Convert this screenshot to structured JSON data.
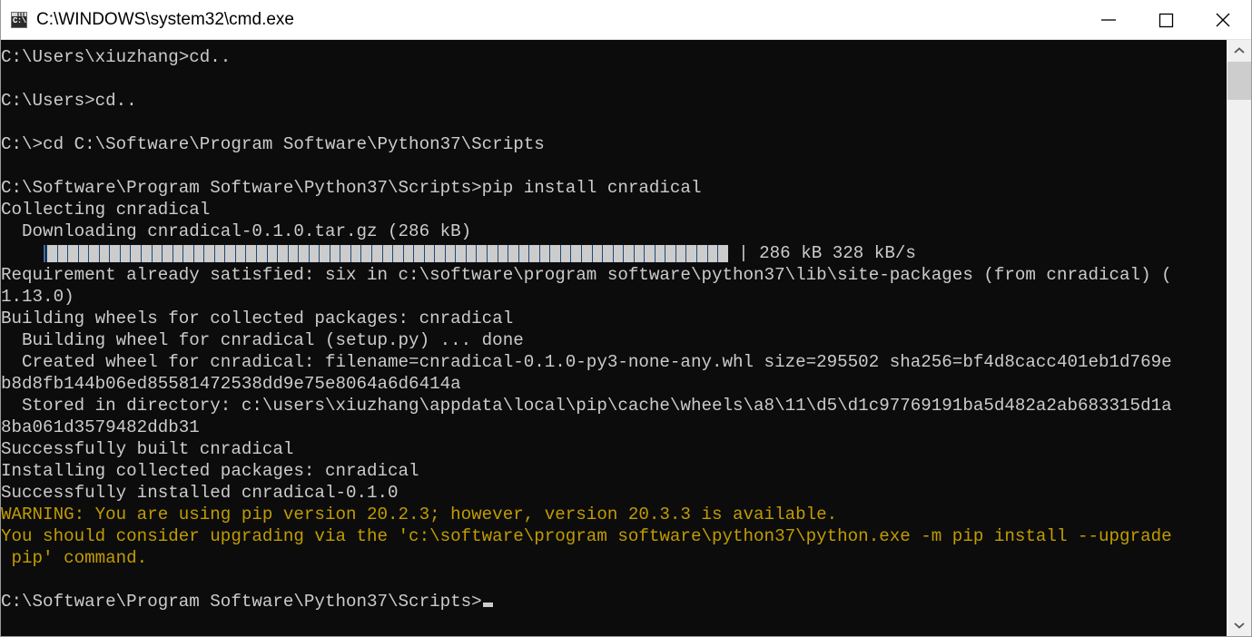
{
  "window": {
    "title": "C:\\WINDOWS\\system32\\cmd.exe",
    "icon_name": "cmd-icon",
    "icon_text": "C:\\",
    "background_color": "#0c0c0c",
    "foreground_color": "#cccccc",
    "warning_color": "#c19c00",
    "titlebar_color": "#ffffff"
  },
  "controls": {
    "minimize_label": "Minimize",
    "maximize_label": "Maximize",
    "close_label": "Close"
  },
  "scrollbar": {
    "up_arrow_label": "Scroll up",
    "down_arrow_label": "Scroll down",
    "thumb_label": "Scroll thumb"
  },
  "terminal": {
    "prompt_current": "C:\\Software\\Program Software\\Python37\\Scripts>",
    "progress": {
      "blocks": 65,
      "indent": "  ",
      "label": "| 286 kB 328 kB/s",
      "size": "286 kB",
      "speed": "328 kB/s"
    },
    "lines": [
      {
        "text": "C:\\Users\\xiuzhang>cd..",
        "style": "normal"
      },
      {
        "text": "",
        "style": "normal"
      },
      {
        "text": "C:\\Users>cd..",
        "style": "normal"
      },
      {
        "text": "",
        "style": "normal"
      },
      {
        "text": "C:\\>cd C:\\Software\\Program Software\\Python37\\Scripts",
        "style": "normal"
      },
      {
        "text": "",
        "style": "normal"
      },
      {
        "text": "C:\\Software\\Program Software\\Python37\\Scripts>pip install cnradical",
        "style": "normal"
      },
      {
        "text": "Collecting cnradical",
        "style": "normal"
      },
      {
        "text": "  Downloading cnradical-0.1.0.tar.gz (286 kB)",
        "style": "normal"
      },
      {
        "text": "__PROGRESS__",
        "style": "progress"
      },
      {
        "text": "Requirement already satisfied: six in c:\\software\\program software\\python37\\lib\\site-packages (from cnradical) (",
        "style": "normal"
      },
      {
        "text": "1.13.0)",
        "style": "normal"
      },
      {
        "text": "Building wheels for collected packages: cnradical",
        "style": "normal"
      },
      {
        "text": "  Building wheel for cnradical (setup.py) ... done",
        "style": "normal"
      },
      {
        "text": "  Created wheel for cnradical: filename=cnradical-0.1.0-py3-none-any.whl size=295502 sha256=bf4d8cacc401eb1d769e",
        "style": "normal"
      },
      {
        "text": "b8d8fb144b06ed85581472538dd9e75e8064a6d6414a",
        "style": "normal"
      },
      {
        "text": "  Stored in directory: c:\\users\\xiuzhang\\appdata\\local\\pip\\cache\\wheels\\a8\\11\\d5\\d1c97769191ba5d482a2ab683315d1a",
        "style": "normal"
      },
      {
        "text": "8ba061d3579482ddb31",
        "style": "normal"
      },
      {
        "text": "Successfully built cnradical",
        "style": "normal"
      },
      {
        "text": "Installing collected packages: cnradical",
        "style": "normal"
      },
      {
        "text": "Successfully installed cnradical-0.1.0",
        "style": "normal"
      },
      {
        "text": "WARNING: You are using pip version 20.2.3; however, version 20.3.3 is available.",
        "style": "warn"
      },
      {
        "text": "You should consider upgrading via the 'c:\\software\\program software\\python37\\python.exe -m pip install --upgrade",
        "style": "warn"
      },
      {
        "text": " pip' command.",
        "style": "warn"
      },
      {
        "text": "",
        "style": "normal"
      },
      {
        "text": "__PROMPT__",
        "style": "prompt"
      }
    ]
  }
}
